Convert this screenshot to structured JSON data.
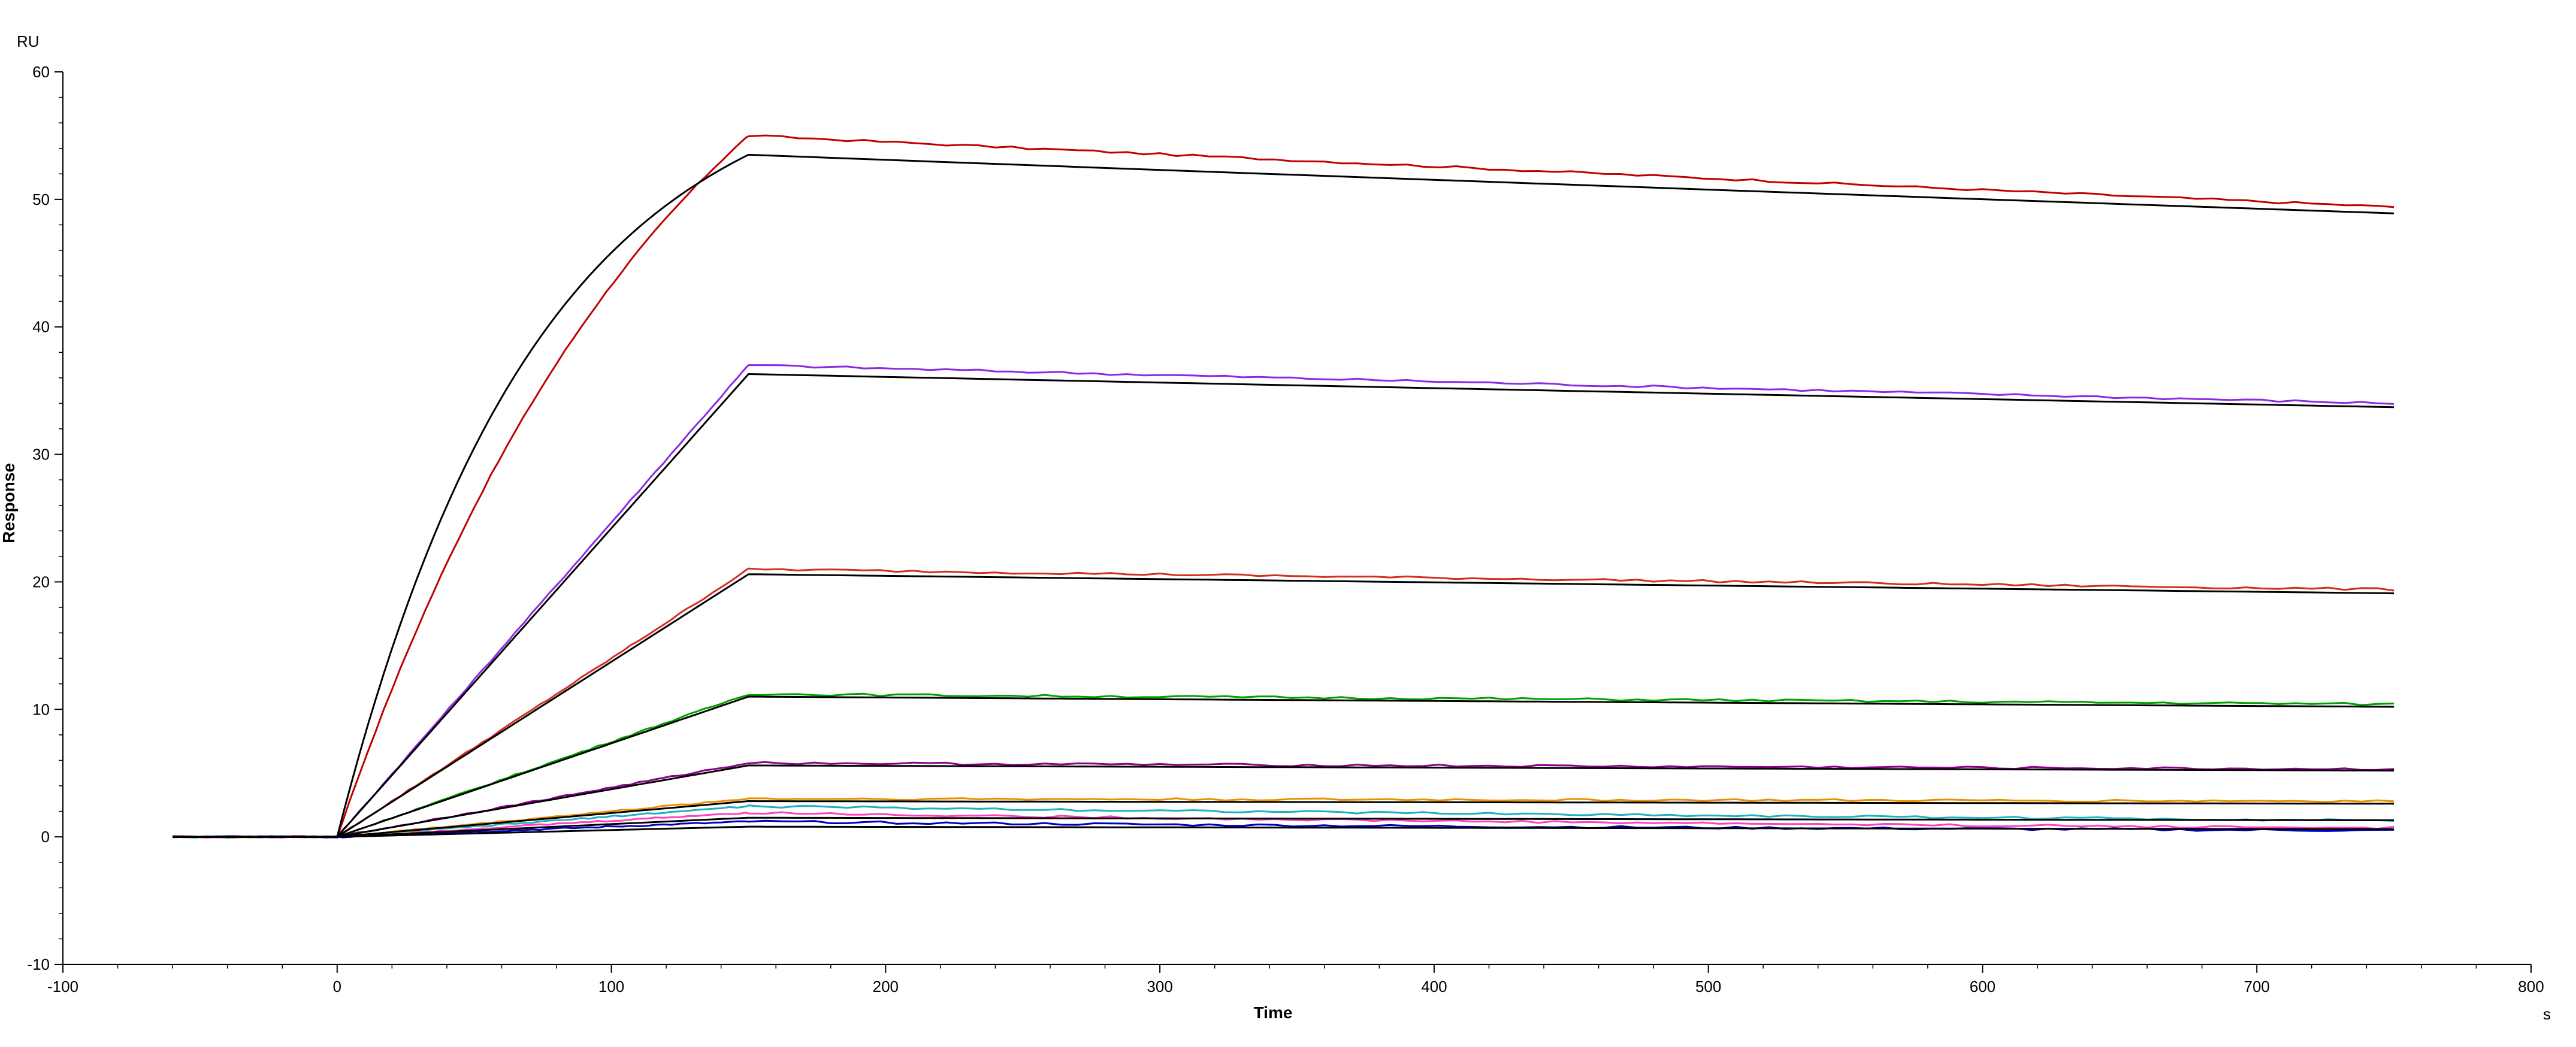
{
  "chart_data": {
    "type": "line",
    "xlabel": "Time",
    "ylabel": "Response",
    "x_unit": "s",
    "y_unit": "RU",
    "xlim": [
      -100,
      800
    ],
    "ylim": [
      -10,
      60
    ],
    "x_ticks": [
      -100,
      0,
      100,
      200,
      300,
      400,
      500,
      600,
      700,
      800
    ],
    "y_ticks": [
      -10,
      0,
      10,
      20,
      30,
      40,
      50,
      60
    ],
    "grid": false,
    "legend": "none",
    "association_end": 150,
    "data_end": 750,
    "series": [
      {
        "color": "#c00000",
        "rmax": 55.0,
        "kobs": 0.0079,
        "end": 49.4
      },
      {
        "color": "#8a2be2",
        "rmax": 37.0,
        "kobs": 0.0,
        "end": 34.0
      },
      {
        "color": "#d03020",
        "rmax": 21.0,
        "kobs": 0.0,
        "end": 19.4
      },
      {
        "color": "#00a000",
        "rmax": 11.2,
        "kobs": 0.0,
        "end": 10.4
      },
      {
        "color": "#8b008b",
        "rmax": 5.8,
        "kobs": 0.0,
        "end": 5.3
      },
      {
        "color": "#e89000",
        "rmax": 3.0,
        "kobs": 0.0,
        "end": 2.8
      },
      {
        "color": "#20b0c0",
        "rmax": 2.4,
        "kobs": 0.0,
        "end": 1.3
      },
      {
        "color": "#ff40c0",
        "rmax": 1.9,
        "kobs": 0.0,
        "end": 0.7
      },
      {
        "color": "#0000c0",
        "rmax": 1.2,
        "kobs": 0.0,
        "end": 0.5
      }
    ],
    "fits": [
      {
        "color": "#000000",
        "rmax": 53.5,
        "kobs": 0.0138,
        "end": 48.9
      },
      {
        "color": "#000000",
        "rmax": 36.3,
        "kobs": 0.0,
        "end": 33.7
      },
      {
        "color": "#000000",
        "rmax": 20.6,
        "kobs": 0.0,
        "end": 19.1
      },
      {
        "color": "#000000",
        "rmax": 11.0,
        "kobs": 0.0,
        "end": 10.2
      },
      {
        "color": "#000000",
        "rmax": 5.6,
        "kobs": 0.0,
        "end": 5.2
      },
      {
        "color": "#000000",
        "rmax": 2.8,
        "kobs": 0.0,
        "end": 2.6
      },
      {
        "color": "#000000",
        "rmax": 1.5,
        "kobs": 0.0,
        "end": 1.3
      },
      {
        "color": "#000000",
        "rmax": 0.8,
        "kobs": 0.0,
        "end": 0.6
      }
    ]
  }
}
